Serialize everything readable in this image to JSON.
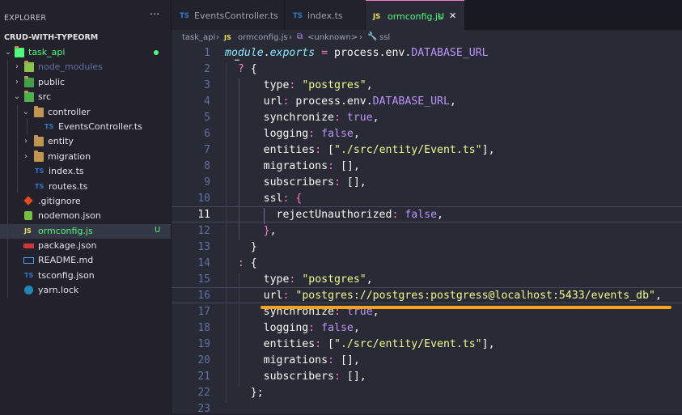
{
  "sidebar": {
    "title": "EXPLORER",
    "more": "···",
    "project": "CRUD-WITH-TYPEORM",
    "items": [
      {
        "label": "task_api",
        "chev": "⌄",
        "type": "folder-root",
        "color": "#50fa7b"
      },
      {
        "label": "node_modules",
        "chev": "›",
        "type": "folder",
        "color": "#6272a4"
      },
      {
        "label": "public",
        "chev": "›",
        "type": "folder"
      },
      {
        "label": "src",
        "chev": "⌄",
        "type": "folder"
      },
      {
        "label": "controller",
        "chev": "⌄",
        "type": "folder"
      },
      {
        "label": "EventsController.ts",
        "type": "ts"
      },
      {
        "label": "entity",
        "chev": "›",
        "type": "folder"
      },
      {
        "label": "migration",
        "chev": "›",
        "type": "folder"
      },
      {
        "label": "index.ts",
        "type": "ts"
      },
      {
        "label": "routes.ts",
        "type": "ts"
      },
      {
        "label": ".gitignore",
        "type": "git"
      },
      {
        "label": "nodemon.json",
        "type": "json"
      },
      {
        "label": "ormconfig.js",
        "type": "js",
        "status": "U",
        "color": "#50fa7b"
      },
      {
        "label": "package.json",
        "type": "npm"
      },
      {
        "label": "README.md",
        "type": "md"
      },
      {
        "label": "tsconfig.json",
        "type": "ts"
      },
      {
        "label": "yarn.lock",
        "type": "yarn"
      }
    ]
  },
  "tabs": [
    {
      "icon": "TS",
      "label": "EventsController.ts"
    },
    {
      "icon": "TS",
      "label": "index.ts"
    },
    {
      "icon": "JS",
      "label": "ormconfig.js",
      "status": "U",
      "close": "✕"
    }
  ],
  "breadcrumb": {
    "folder": "task_api",
    "sep": "›",
    "icon": "JS",
    "file": "ormconfig.js",
    "symbol": "<unknown>",
    "prop": "ssl"
  },
  "editor": {
    "lines": [
      "1",
      "2",
      "3",
      "4",
      "5",
      "6",
      "7",
      "8",
      "9",
      "10",
      "11",
      "12",
      "13",
      "14",
      "15",
      "16",
      "17",
      "18",
      "19",
      "20",
      "21",
      "22",
      "23"
    ],
    "current_line": "11",
    "highlight_line": "16"
  },
  "colors": {
    "accent": "#ff79c6",
    "underline": "#f7a21b",
    "untracked": "#50fa7b"
  }
}
